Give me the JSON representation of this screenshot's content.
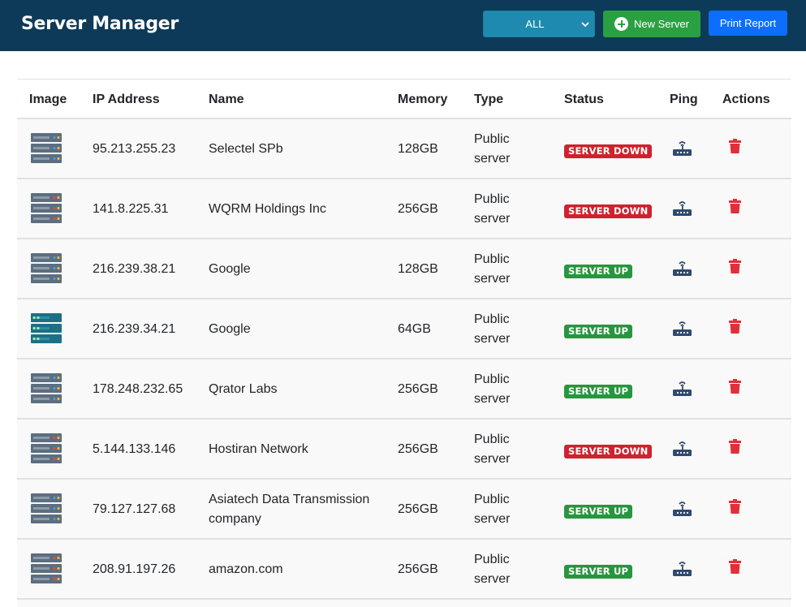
{
  "header": {
    "title": "Server Manager",
    "filter": {
      "selected": "ALL"
    },
    "new_server_label": "New Server",
    "print_label": "Print Report"
  },
  "table": {
    "columns": [
      "Image",
      "IP Address",
      "Name",
      "Memory",
      "Type",
      "Status",
      "Ping",
      "Actions"
    ],
    "rows": [
      {
        "image": "server-rack-blue-leds",
        "ip": "95.213.255.23",
        "name": "Selectel SPb",
        "memory": "128GB",
        "type_line1": "Public",
        "type_line2": "server",
        "status": "SERVER DOWN",
        "status_kind": "down"
      },
      {
        "image": "server-rack-grey-leds",
        "ip": "141.8.225.31",
        "name": "WQRM Holdings Inc",
        "memory": "256GB",
        "type_line1": "Public",
        "type_line2": "server",
        "status": "SERVER DOWN",
        "status_kind": "down"
      },
      {
        "image": "server-rack-blue-leds",
        "ip": "216.239.38.21",
        "name": "Google",
        "memory": "128GB",
        "type_line1": "Public",
        "type_line2": "server",
        "status": "SERVER UP",
        "status_kind": "up"
      },
      {
        "image": "server-rack-teal",
        "ip": "216.239.34.21",
        "name": "Google",
        "memory": "64GB",
        "type_line1": "Public",
        "type_line2": "server",
        "status": "SERVER UP",
        "status_kind": "up"
      },
      {
        "image": "server-rack-blue-leds",
        "ip": "178.248.232.65",
        "name": "Qrator Labs",
        "memory": "256GB",
        "type_line1": "Public",
        "type_line2": "server",
        "status": "SERVER UP",
        "status_kind": "up"
      },
      {
        "image": "server-rack-grey-leds",
        "ip": "5.144.133.146",
        "name": "Hostiran Network",
        "memory": "256GB",
        "type_line1": "Public",
        "type_line2": "server",
        "status": "SERVER DOWN",
        "status_kind": "down"
      },
      {
        "image": "server-rack-blue-leds",
        "ip": "79.127.127.68",
        "name": "Asiatech Data Transmission company",
        "memory": "256GB",
        "type_line1": "Public",
        "type_line2": "server",
        "status": "SERVER UP",
        "status_kind": "up"
      },
      {
        "image": "server-rack-grey-leds",
        "ip": "208.91.197.26",
        "name": "amazon.com",
        "memory": "256GB",
        "type_line1": "Public",
        "type_line2": "server",
        "status": "SERVER UP",
        "status_kind": "up"
      }
    ]
  },
  "icons": {
    "filter_chevron": "chevron-down-icon",
    "new_server": "plus-circle-icon",
    "ping": "router-icon",
    "delete": "trash-icon"
  },
  "colors": {
    "navbar": "#0d3a58",
    "filter": "#1f8aaf",
    "new_server": "#2aa043",
    "print": "#0d6efd",
    "status_down": "#d0212f",
    "status_up": "#27963f",
    "delete": "#e0303a",
    "ping": "#2f4a6d"
  }
}
